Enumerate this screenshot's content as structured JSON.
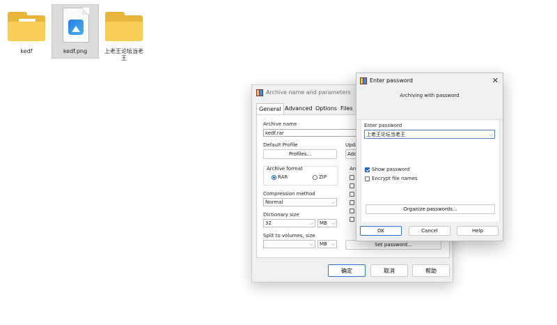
{
  "desktop": {
    "icons": [
      {
        "label": "kedf"
      },
      {
        "label": "kedf.png"
      },
      {
        "label": "上老王论坛当老王"
      }
    ]
  },
  "main_dialog": {
    "title": "Archive name and parameters",
    "tabs": [
      "General",
      "Advanced",
      "Options",
      "Files"
    ],
    "archive_name_label": "Archive name",
    "archive_name_value": "kedf.rar",
    "default_profile_label": "Default Profile",
    "profiles_button": "Profiles...",
    "update_label": "Upda",
    "add_button": "Add",
    "archive_format_label": "Archive format",
    "format_rar": "RAR",
    "format_zip": "ZIP",
    "archiving_options_label": "Arc",
    "compression_method_label": "Compression method",
    "compression_method_value": "Normal",
    "dictionary_size_label": "Dictionary size",
    "dictionary_size_value": "32",
    "dictionary_unit": "MB",
    "split_label": "Split to volumes, size",
    "split_value": "",
    "split_unit": "MB",
    "set_password_button": "Set password...",
    "ok_button": "确定",
    "cancel_button": "取消",
    "help_button": "帮助"
  },
  "password_dialog": {
    "title": "Enter password",
    "subtitle": "Archiving with password",
    "enter_password_label": "Enter password",
    "password_value": "上老王论坛当老王",
    "show_password_label": "Show password",
    "show_password_checked": true,
    "encrypt_file_names_label": "Encrypt file names",
    "encrypt_file_names_checked": false,
    "organize_button": "Organize passwords...",
    "ok_button": "OK",
    "cancel_button": "Cancel",
    "help_button": "Help"
  },
  "colors": {
    "accent": "#2563b8",
    "folder": "#f8cd58"
  }
}
